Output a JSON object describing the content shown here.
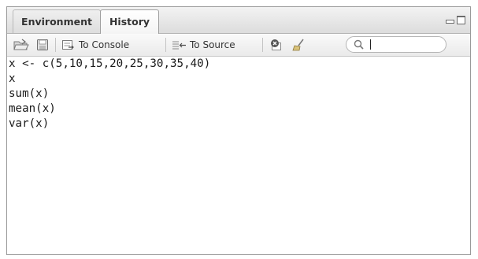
{
  "tabs": [
    {
      "label": "Environment",
      "active": false
    },
    {
      "label": "History",
      "active": true
    }
  ],
  "toolbar": {
    "load_icon": "open-folder-icon",
    "save_icon": "save-disk-icon",
    "to_console_label": "To Console",
    "to_source_label": "To Source",
    "remove_icon": "remove-entry-icon",
    "clear_icon": "broom-icon",
    "search_placeholder": "",
    "search_value": ""
  },
  "history": [
    "x <- c(5,10,15,20,25,30,35,40)",
    "x",
    "sum(x)",
    "mean(x)",
    "var(x)"
  ],
  "colors": {
    "pane_border": "#9a9a9a",
    "tab_bar": "#dcdcdc",
    "toolbar": "#eaeaea",
    "text": "#1a1a1a"
  }
}
